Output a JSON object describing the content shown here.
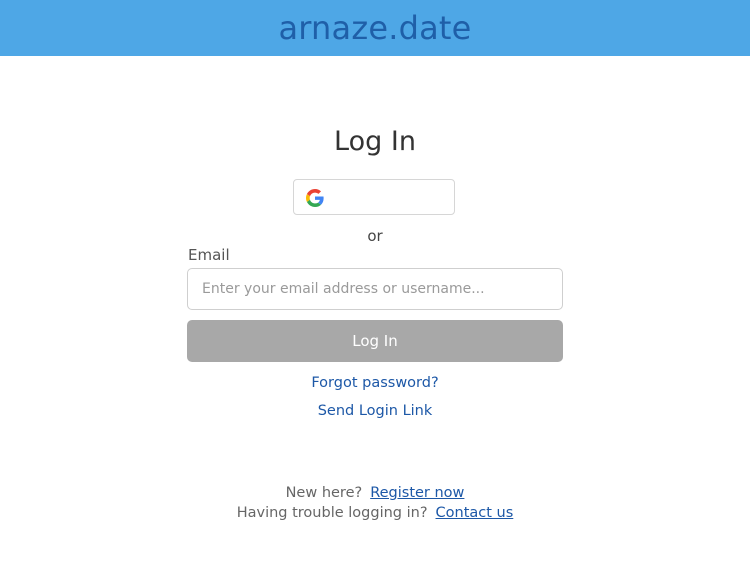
{
  "header": {
    "brand": "arnaze.date",
    "background_color": "#4ea7e6",
    "brand_color": "#1f5fa8"
  },
  "login": {
    "title": "Log In",
    "google_icon": "google-icon",
    "or_text": "or",
    "email_label": "Email",
    "email_placeholder": "Enter your email address or username...",
    "email_value": "",
    "submit_label": "Log In",
    "submit_color": "#a8a8a8",
    "forgot_password": "Forgot password?",
    "send_login_link": "Send Login Link",
    "link_color": "#1d58a7"
  },
  "footer": {
    "new_here_text": "New here?",
    "register_link": "Register now",
    "trouble_text": "Having trouble logging in?",
    "contact_link": "Contact us"
  }
}
